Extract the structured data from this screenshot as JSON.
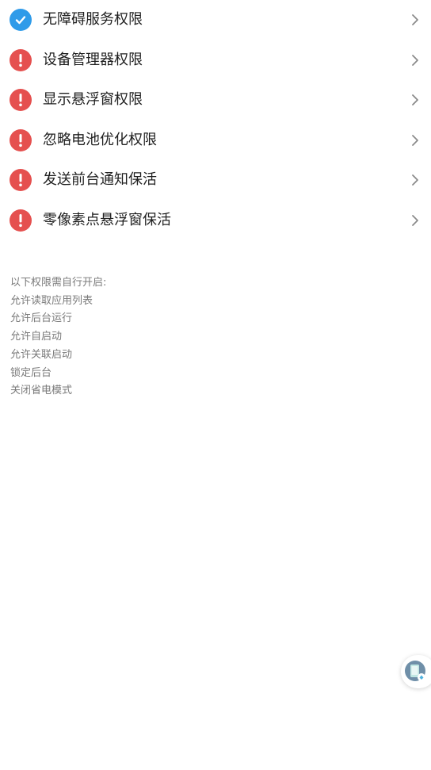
{
  "permissions": [
    {
      "label": "无障碍服务权限",
      "status": "granted"
    },
    {
      "label": "设备管理器权限",
      "status": "missing"
    },
    {
      "label": "显示悬浮窗权限",
      "status": "missing"
    },
    {
      "label": "忽略电池优化权限",
      "status": "missing"
    },
    {
      "label": "发送前台通知保活",
      "status": "missing"
    },
    {
      "label": "零像素点悬浮窗保活",
      "status": "missing"
    }
  ],
  "notes": {
    "heading": "以下权限需自行开启:",
    "items": [
      "允许读取应用列表",
      "允许后台运行",
      "允许自启动",
      "允许关联启动",
      "锁定后台",
      "关闭省电模式"
    ]
  },
  "colors": {
    "granted": "#2f9be9",
    "missing": "#e5504f",
    "chevron": "#8a8a8a",
    "note_text": "#7a7a7a"
  },
  "icons": {
    "granted": "check-circle-icon",
    "missing": "exclamation-circle-icon",
    "row_arrow": "chevron-right-icon",
    "floating": "assistant-bubble-icon"
  }
}
